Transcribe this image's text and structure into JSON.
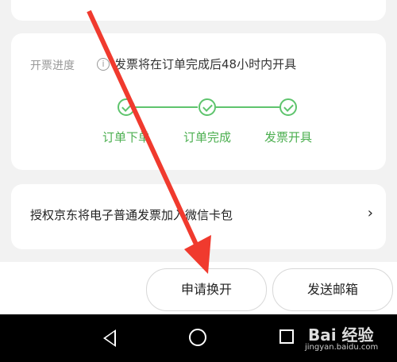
{
  "progress": {
    "label": "开票进度",
    "info_icon": "info-icon",
    "info_text": "发票将在订单完成后48小时内开具",
    "steps": [
      {
        "label": "订单下单"
      },
      {
        "label": "订单完成"
      },
      {
        "label": "发票开具"
      }
    ],
    "accent_color": "#5ec46d"
  },
  "auth": {
    "text": "授权京东将电子普通发票加入微信卡包",
    "chevron": "›"
  },
  "actions": {
    "apply_label": "申请换开",
    "send_label": "发送邮箱"
  },
  "watermark": {
    "brand": "Bai 经验",
    "url": "jingyan.baidu.com"
  },
  "annotation": {
    "arrow_color": "#f03a2e"
  }
}
